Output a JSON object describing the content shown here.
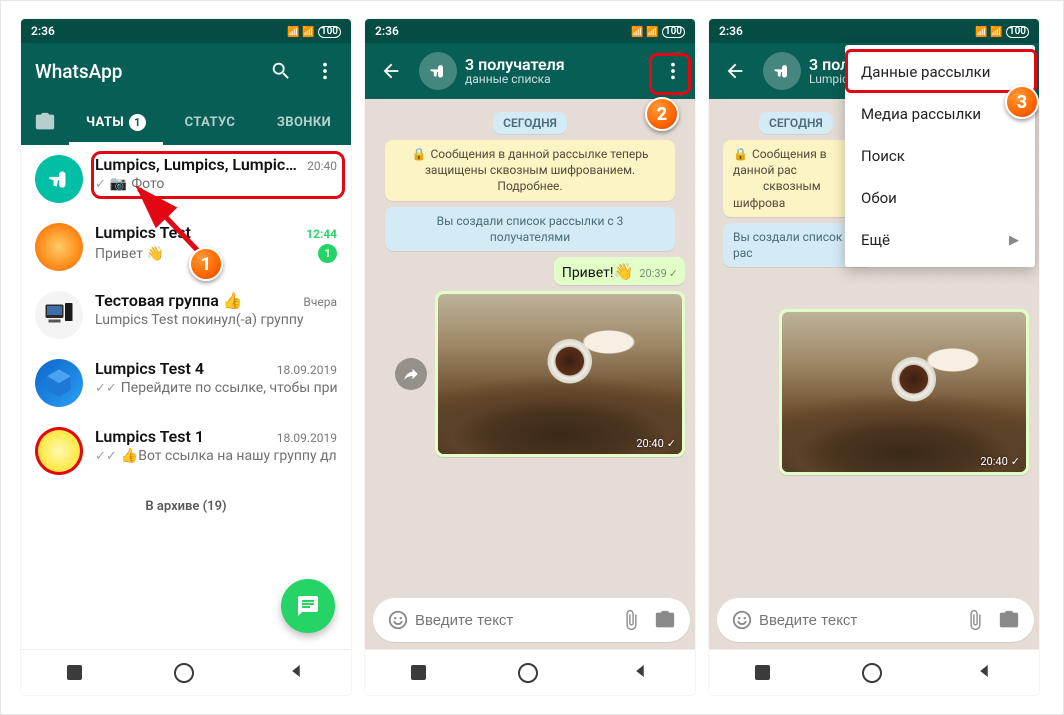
{
  "status": {
    "time": "2:36",
    "battery": "100"
  },
  "screen1": {
    "app_title": "WhatsApp",
    "tabs": {
      "chats": "ЧАТЫ",
      "chats_badge": "1",
      "status": "СТАТУС",
      "calls": "ЗВОНКИ"
    },
    "chats": [
      {
        "name": "Lumpics, Lumpics, Lumpics Te...",
        "time": "20:40",
        "preview": "Фото",
        "ticks": "single",
        "photo_icon": true
      },
      {
        "name": "Lumpics Test",
        "time": "12:44",
        "preview": "Привет 👋",
        "unread": "1"
      },
      {
        "name": "Тестовая группа 👍",
        "time": "Вчера",
        "preview": "Lumpics Test покинул(-а) группу"
      },
      {
        "name": "Lumpics Test 4",
        "time": "18.09.2019",
        "preview": "Перейдите по ссылке, чтобы прис...",
        "ticks": "double"
      },
      {
        "name": "Lumpics Test 1",
        "time": "18.09.2019",
        "preview": "👍Вот ссылка на нашу группу для...",
        "ticks": "double"
      }
    ],
    "archive": "В архиве (19)"
  },
  "screen2": {
    "title": "3 получателя",
    "subtitle": "данные списка",
    "date_chip": "СЕГОДНЯ",
    "info1": "Сообщения в данной рассылке теперь защищены сквозным шифрованием. Подробнее.",
    "info2": "Вы создали список рассылки с 3 получателями",
    "msg1": {
      "text": "Привет!",
      "emoji": "👋",
      "time": "20:39"
    },
    "img_time": "20:40",
    "input_placeholder": "Введите текст"
  },
  "screen3": {
    "title": "3 получателя",
    "subtitle": "Lumpics, Lumpics, L",
    "date_chip": "СЕГОДНЯ",
    "info1": "Сообщения в данной рас",
    "info1b": "сквозным шифрова",
    "info2": "Вы создали список рас",
    "menu": {
      "item1": "Данные рассылки",
      "item2": "Медиа рассылки",
      "item3": "Поиск",
      "item4": "Обои",
      "item5": "Ещё"
    },
    "img_time": "20:40",
    "input_placeholder": "Введите текст"
  }
}
